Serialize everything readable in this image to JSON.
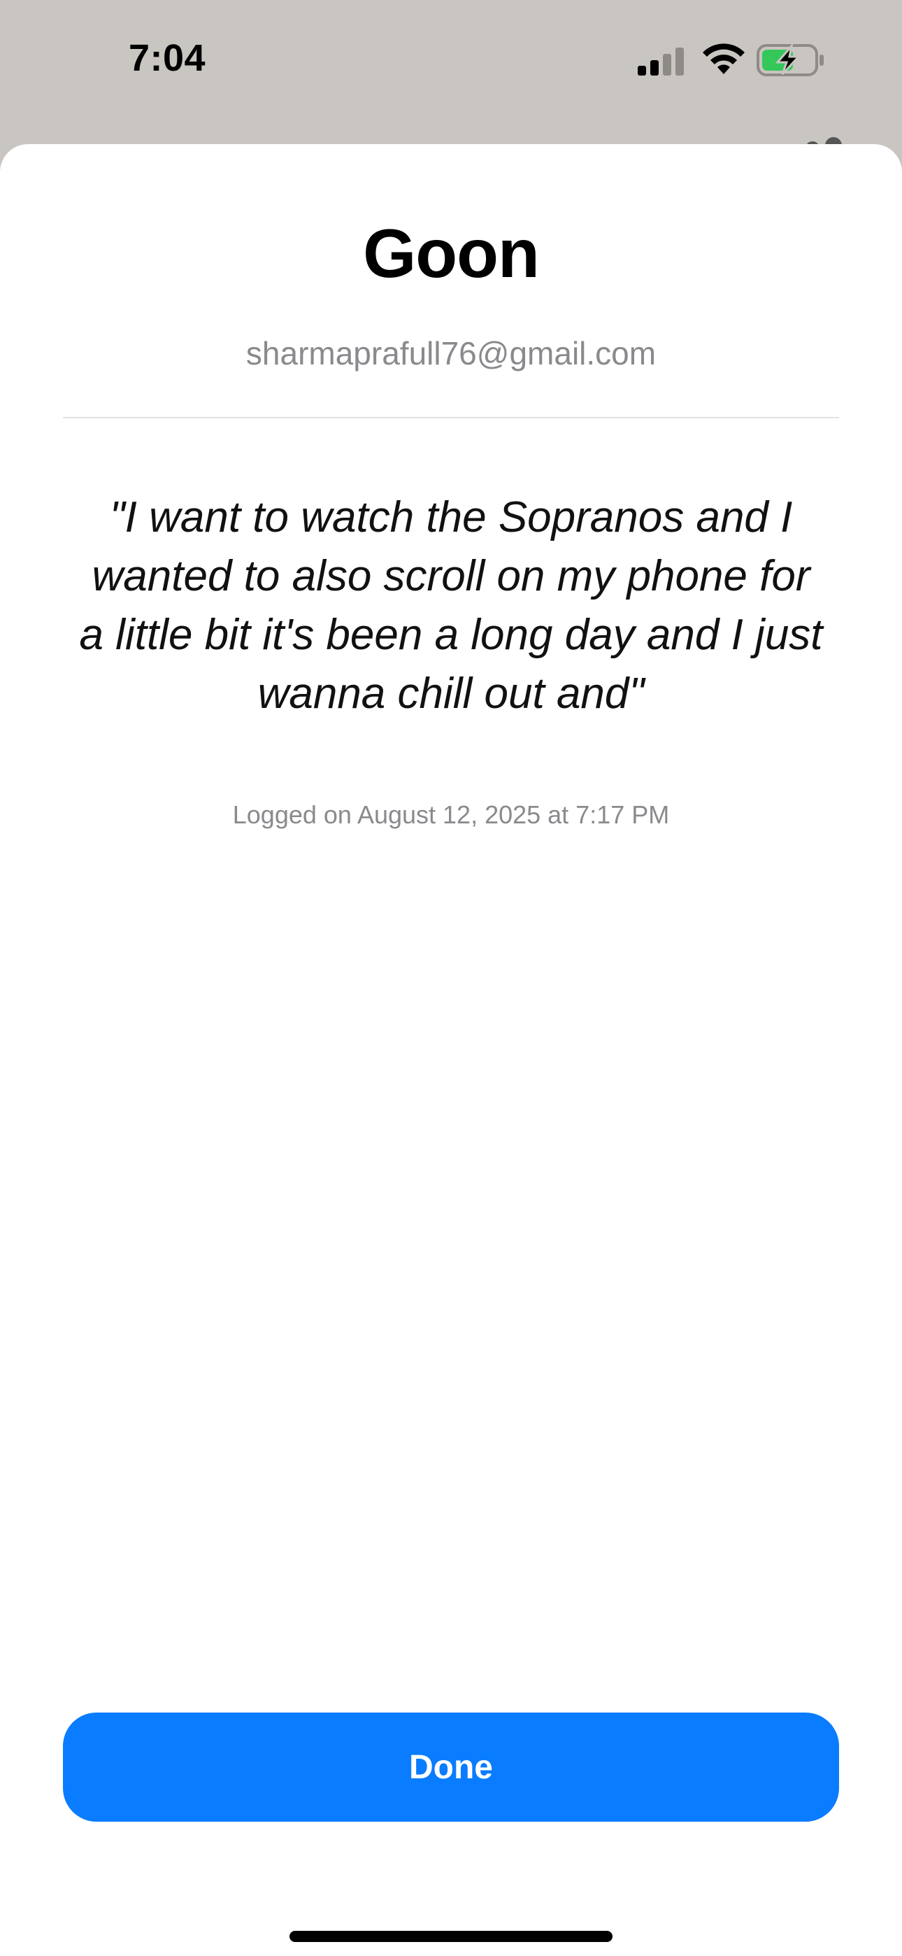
{
  "status_bar": {
    "time": "7:04",
    "icons": [
      "cellular-signal-icon",
      "wifi-icon",
      "battery-charging-icon"
    ],
    "battery_color": "#34c759"
  },
  "sheet": {
    "title": "Goon",
    "email": "sharmaprafull76@gmail.com",
    "quote": "\"I want to watch the Sopranos and I wanted to also scroll on my phone for a little bit it's been a long day and I just wanna chill out and\"",
    "logged": "Logged on August 12, 2025 at 7:17 PM",
    "done_label": "Done",
    "accent_color": "#0a7cff"
  }
}
